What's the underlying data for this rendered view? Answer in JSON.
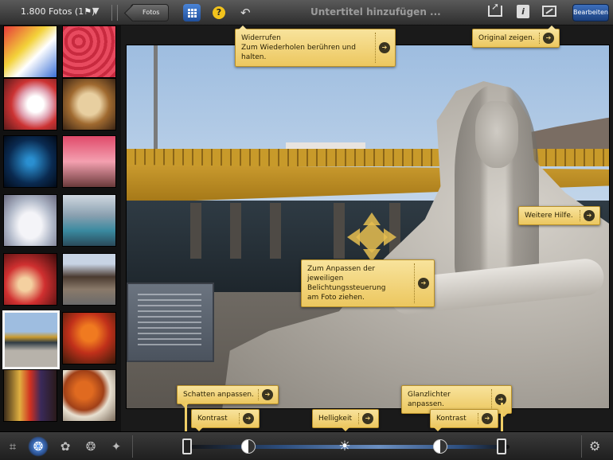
{
  "toolbar": {
    "album_title": "1.800 Fotos (1⚑)",
    "album_caret": "▼",
    "back_label": "Fotos",
    "help_label": "?",
    "undo_glyph": "↶",
    "caption_placeholder": "Untertitel hinzufügen ...",
    "info_label": "i",
    "edit_label": "Bearbeiten"
  },
  "tips": {
    "undo": {
      "line1": "Widerrufen",
      "line2": "Zum Wiederholen berühren und halten."
    },
    "original": "Original zeigen.",
    "more_help": "Weitere Hilfe.",
    "drag": {
      "line1": "Zum Anpassen der jeweiligen",
      "line2": "Belichtungssteuerung",
      "line3": "am Foto ziehen."
    },
    "shadows": "Schatten anpassen.",
    "contrast_left": "Kontrast",
    "brightness": "Helligkeit",
    "contrast_right": "Kontrast",
    "highlights": "Glanzlichter anpassen.",
    "arrow": "➔"
  },
  "bottom": {
    "crop_glyph": "⌗",
    "exposure_glyph": "❂",
    "color_glyph": "✿",
    "brush_glyph": "❂",
    "effects_glyph": "✦",
    "sun_glyph": "☀",
    "gear_glyph": "⚙"
  },
  "colors": {
    "tip_bg": "#f3d57e",
    "accent_blue": "#2f66c0",
    "help_yellow": "#f2c31c"
  }
}
